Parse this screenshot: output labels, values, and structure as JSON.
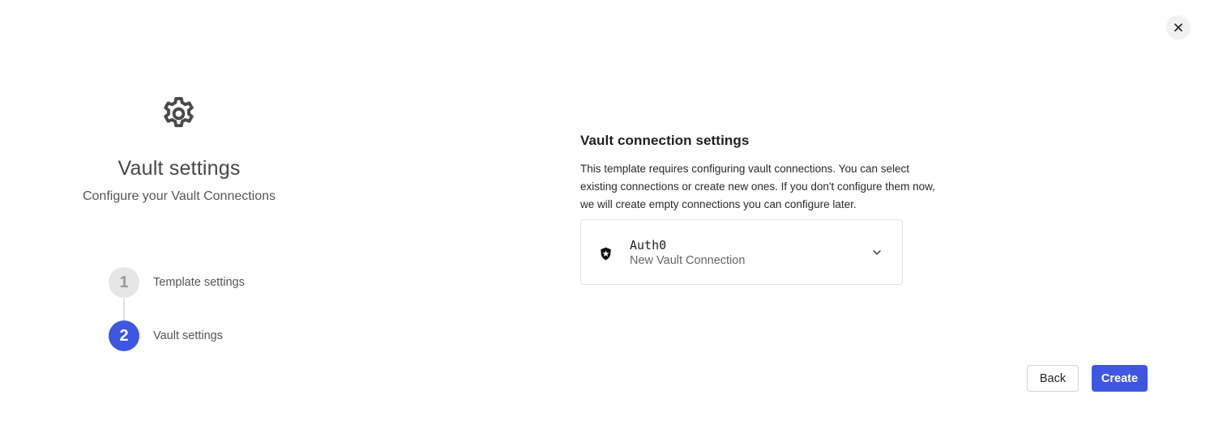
{
  "wizard": {
    "close_label": "Close",
    "header": {
      "title": "Vault settings",
      "subtitle": "Configure your Vault Connections",
      "icon": "gear-icon"
    },
    "steps": [
      {
        "number": "1",
        "label": "Template settings",
        "state": "done"
      },
      {
        "number": "2",
        "label": "Vault settings",
        "state": "active"
      }
    ]
  },
  "vault_section": {
    "title": "Vault connection settings",
    "description": "This template requires configuring vault connections. You can select existing connections or create new ones. If you don't configure them now, we will create empty connections you can configure later.",
    "connections": [
      {
        "name": "Auth0",
        "subtitle": "New Vault Connection",
        "icon": "shield-icon"
      }
    ]
  },
  "footer": {
    "back_label": "Back",
    "create_label": "Create"
  },
  "colors": {
    "accent": "#3f57e0",
    "step_done_bg": "#e6e6e6",
    "border": "#e2e2e2"
  }
}
